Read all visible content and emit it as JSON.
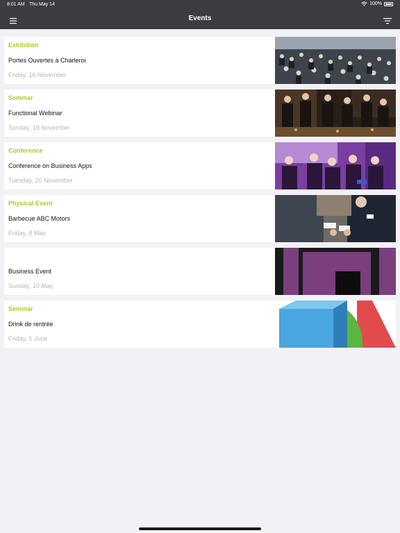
{
  "status": {
    "time": "8:01 AM",
    "date": "Thu May 14",
    "battery": "100%"
  },
  "nav": {
    "title": "Events",
    "menu_icon": "hamburger-menu-icon",
    "filter_icon": "filter-icon"
  },
  "events": [
    {
      "type": "Exhibition",
      "title": "Portes Ouvertes à Charleroi",
      "date": "Friday, 16 November",
      "image": "crowd-exhibition-photo"
    },
    {
      "type": "Seminar",
      "title": "Functional Webinar",
      "date": "Sunday, 18 November",
      "image": "seminar-people-photo"
    },
    {
      "type": "Conference",
      "title": "Conference on Business Apps",
      "date": "Tuesday, 20 November",
      "image": "conference-audience-photo"
    },
    {
      "type": "Physical Event",
      "title": "Barbecue ABC Motors",
      "date": "Friday, 8 May",
      "image": "business-card-exchange-photo"
    },
    {
      "type": "",
      "title": "Business Event",
      "date": "Sunday, 10 May",
      "image": "purple-square-graphic"
    },
    {
      "type": "Seminar",
      "title": "Drink de rentrée",
      "date": "Friday, 5 June",
      "image": "colorful-shapes-graphic"
    }
  ],
  "colors": {
    "bar": "#3b3d40",
    "accent": "#a8cc28",
    "background": "#f2f2f6",
    "date": "#b7b7bb"
  }
}
